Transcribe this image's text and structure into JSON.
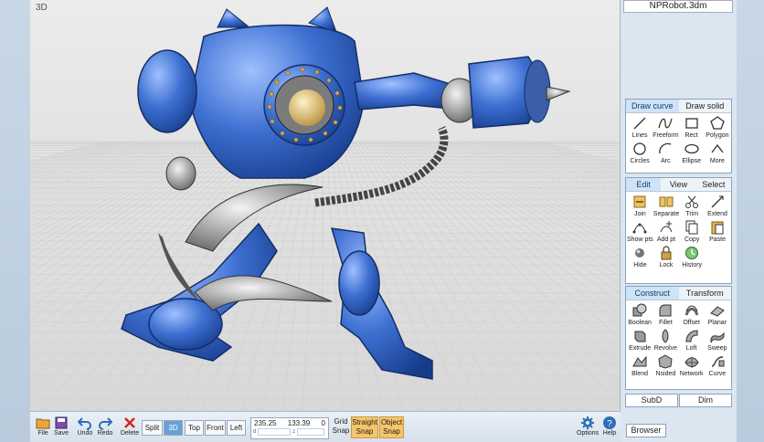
{
  "viewport": {
    "label": "3D"
  },
  "file": {
    "title": "NPRobot.3dm"
  },
  "draw_group": {
    "tabs": [
      "Draw curve",
      "Draw solid"
    ],
    "tools": [
      "Lines",
      "Freeform",
      "Rect",
      "Polygon",
      "Circles",
      "Arc",
      "Ellipse",
      "More"
    ]
  },
  "edit_group": {
    "tabs": [
      "Edit",
      "View",
      "Select"
    ],
    "tools": [
      "Join",
      "Separate",
      "Trim",
      "Extend",
      "Show pts",
      "Add pt",
      "Copy",
      "Paste",
      "Hide",
      "Lock",
      "History"
    ]
  },
  "construct_group": {
    "tabs": [
      "Construct",
      "Transform"
    ],
    "tools": [
      "Boolean",
      "Fillet",
      "Offset",
      "Planar",
      "Extrude",
      "Revolve",
      "Loft",
      "Sweep",
      "Blend",
      "Nsided",
      "Network",
      "Curve"
    ]
  },
  "sub_row": {
    "subd": "SubD",
    "dim": "Dim"
  },
  "browser_label": "Browser",
  "toolbar": {
    "file": "File",
    "save": "Save",
    "undo": "Undo",
    "redo": "Redo",
    "delete": "Delete",
    "views": [
      "Split",
      "3D",
      "Top",
      "Front",
      "Left"
    ],
    "coord_x": "235.25",
    "coord_y": "133.39",
    "coord_z": "0",
    "coord_d": "d",
    "coord_zl": "z",
    "grid_snap_1": "Grid",
    "grid_snap_2": "Snap",
    "straight_1": "Straight",
    "straight_2": "Snap",
    "object_1": "Object",
    "object_2": "Snap",
    "options": "Options",
    "help": "Help"
  },
  "colors": {
    "accent": "#6aa0d8",
    "snap": "#f6c46a",
    "robot": "#3d6fd1"
  }
}
